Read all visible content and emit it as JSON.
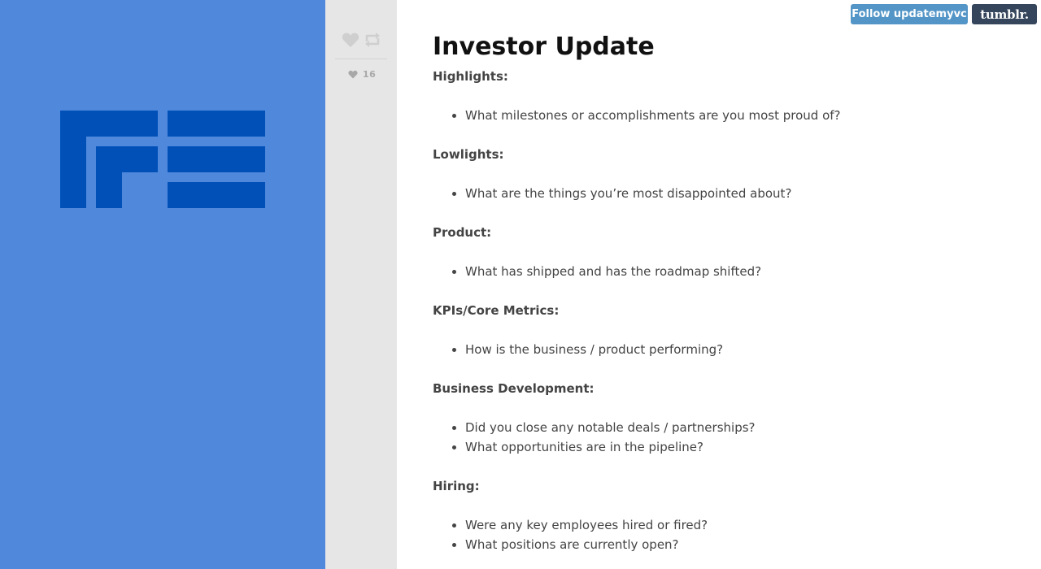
{
  "sidebar": {
    "background_color": "#5089dc",
    "logo_color": "#0050b8",
    "logo_name": "first-round-logo"
  },
  "controls": {
    "like_icon": "heart-icon",
    "reblog_icon": "reblog-icon",
    "notes_count": "16"
  },
  "header": {
    "follow_label": "Follow updatemyvc",
    "tumblr_label": "tumblr."
  },
  "post": {
    "title": "Investor Update",
    "sections": [
      {
        "heading": "Highlights:",
        "items": [
          "What milestones or accomplishments are you most proud of?"
        ]
      },
      {
        "heading": "Lowlights:",
        "items": [
          "What are the things you’re most disappointed about?"
        ]
      },
      {
        "heading": "Product:",
        "items": [
          "What has shipped and has the roadmap shifted?"
        ]
      },
      {
        "heading": "KPIs/Core Metrics:",
        "items": [
          "How is the business / product performing?"
        ]
      },
      {
        "heading": "Business Development:",
        "items": [
          "Did you close any notable deals / partnerships?",
          "What opportunities are in the pipeline?"
        ]
      },
      {
        "heading": "Hiring:",
        "items": [
          "Were any key employees hired or fired?",
          "What positions are currently open?"
        ]
      }
    ]
  }
}
